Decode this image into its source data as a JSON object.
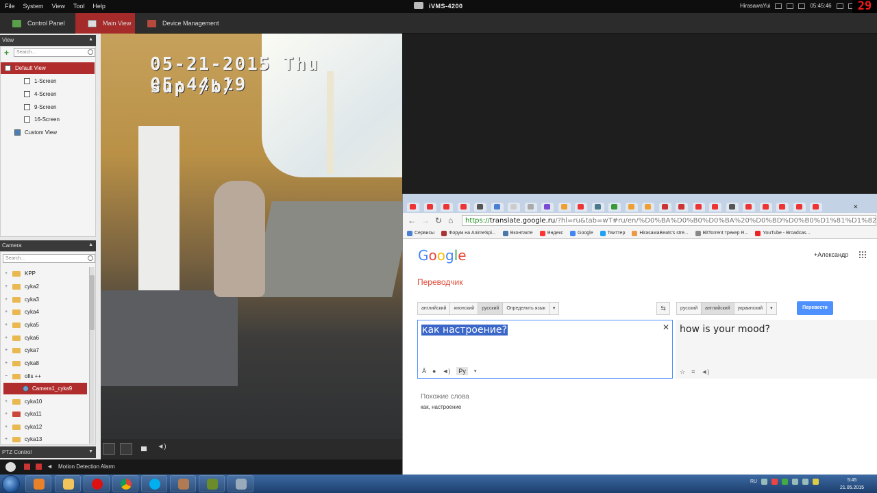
{
  "menubar": {
    "items": [
      "File",
      "System",
      "View",
      "Tool",
      "Help"
    ],
    "app_title": "iVMS-4200",
    "user": "HirasawaYui",
    "time": "05:45:46",
    "counter": "29"
  },
  "tabs": [
    {
      "label": "Control Panel",
      "active": false
    },
    {
      "label": "Main View",
      "active": true
    },
    {
      "label": "Device Management",
      "active": false
    }
  ],
  "view_panel": {
    "title": "View",
    "search_placeholder": "Search...",
    "items": [
      "Default View",
      "1-Screen",
      "4-Screen",
      "9-Screen",
      "16-Screen",
      "Custom View"
    ]
  },
  "camera_panel": {
    "title": "Camera",
    "search_placeholder": "Search...",
    "items": [
      "KPP",
      "cyka2",
      "cyka3",
      "cyka4",
      "cyka5",
      "cyka6",
      "cyka7",
      "cyka8",
      "ofis ++",
      "Camera1_cyka9",
      "cyka10",
      "cyka11",
      "cyka12",
      "cyka13"
    ]
  },
  "ptz_panel": {
    "title": "PTZ Control"
  },
  "osd": {
    "line1": "05-21-2015 Thu 05:44:19",
    "line2": "sup /b/"
  },
  "status": {
    "alarm_label": "Motion Detection Alarm"
  },
  "browser": {
    "url_scheme": "https://",
    "url_host": "translate.google.ru",
    "url_rest": "/?hl=ru&tab=wT#ru/en/%D0%BA%D0%B0%D0%BA%20%D0%BD%D0%B0%D1%81%D1%82%D1",
    "bookmarks": [
      "Сервисы",
      "Форум на AnimeSpi...",
      "Вконтакте",
      "Яндекс",
      "Google",
      "Твиттер",
      "HirasawaBeats's stre...",
      "BitTorrent трекер R...",
      "YouTube - Broadcas..."
    ],
    "google_logo": "Google",
    "user": "+Александр",
    "page_title": "Переводчик",
    "source_langs": [
      "английский",
      "японский",
      "русский",
      "Определить язык"
    ],
    "source_selected": "русский",
    "target_langs": [
      "русский",
      "английский",
      "украинский"
    ],
    "target_selected": "английский",
    "translate_button": "Перевести",
    "source_text": "как настроение?",
    "input_lang_badge": "Ру",
    "output_text": "how is your mood?",
    "similar_title": "Похожие слова",
    "similar_words": "как, настроение"
  },
  "tray": {
    "lang": "RU",
    "clock_time": "5:45",
    "clock_date": "21.05.2015"
  },
  "colors": {
    "accent_red": "#a52a2a",
    "google_blue": "#4d90fe",
    "translate_red": "#dd4b39",
    "counter_red": "#f21b1b"
  }
}
